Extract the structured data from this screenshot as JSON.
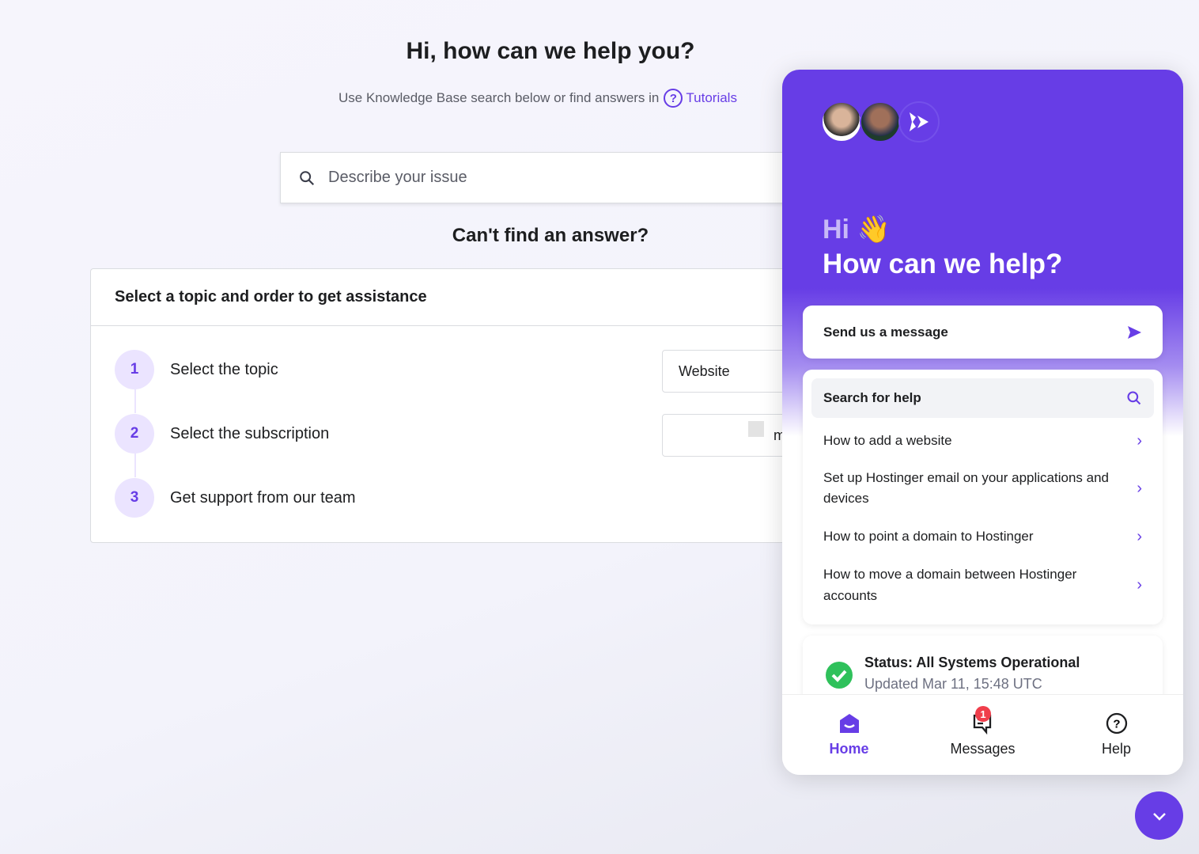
{
  "page": {
    "title": "Hi, how can we help you?",
    "subtitle": "Use Knowledge Base search below or find answers in",
    "tutorials_link": "Tutorials",
    "search_placeholder": "Describe your issue",
    "cant_find": "Can't find an answer?"
  },
  "assist_card": {
    "header": "Select a topic and order to get assistance",
    "steps": [
      {
        "number": "1",
        "label": "Select the topic",
        "value": "Website"
      },
      {
        "number": "2",
        "label": "Select the subscription",
        "value": "m"
      },
      {
        "number": "3",
        "label": "Get support from our team"
      }
    ]
  },
  "widget": {
    "greeting": "Hi",
    "greeting_emoji": "👋",
    "headline": "How can we help?",
    "send_message": "Send us a message",
    "search_help": "Search for help",
    "articles": [
      "How to add a website",
      "Set up Hostinger email on your applications and devices",
      "How to point a domain to Hostinger",
      "How to move a domain between Hostinger accounts"
    ],
    "status": {
      "title": "Status: All Systems Operational",
      "updated": "Updated Mar 11, 15:48 UTC",
      "color": "#2fc15b"
    },
    "nav": [
      {
        "label": "Home",
        "active": true
      },
      {
        "label": "Messages",
        "badge": "1"
      },
      {
        "label": "Help"
      }
    ],
    "accent": "#673de6"
  }
}
